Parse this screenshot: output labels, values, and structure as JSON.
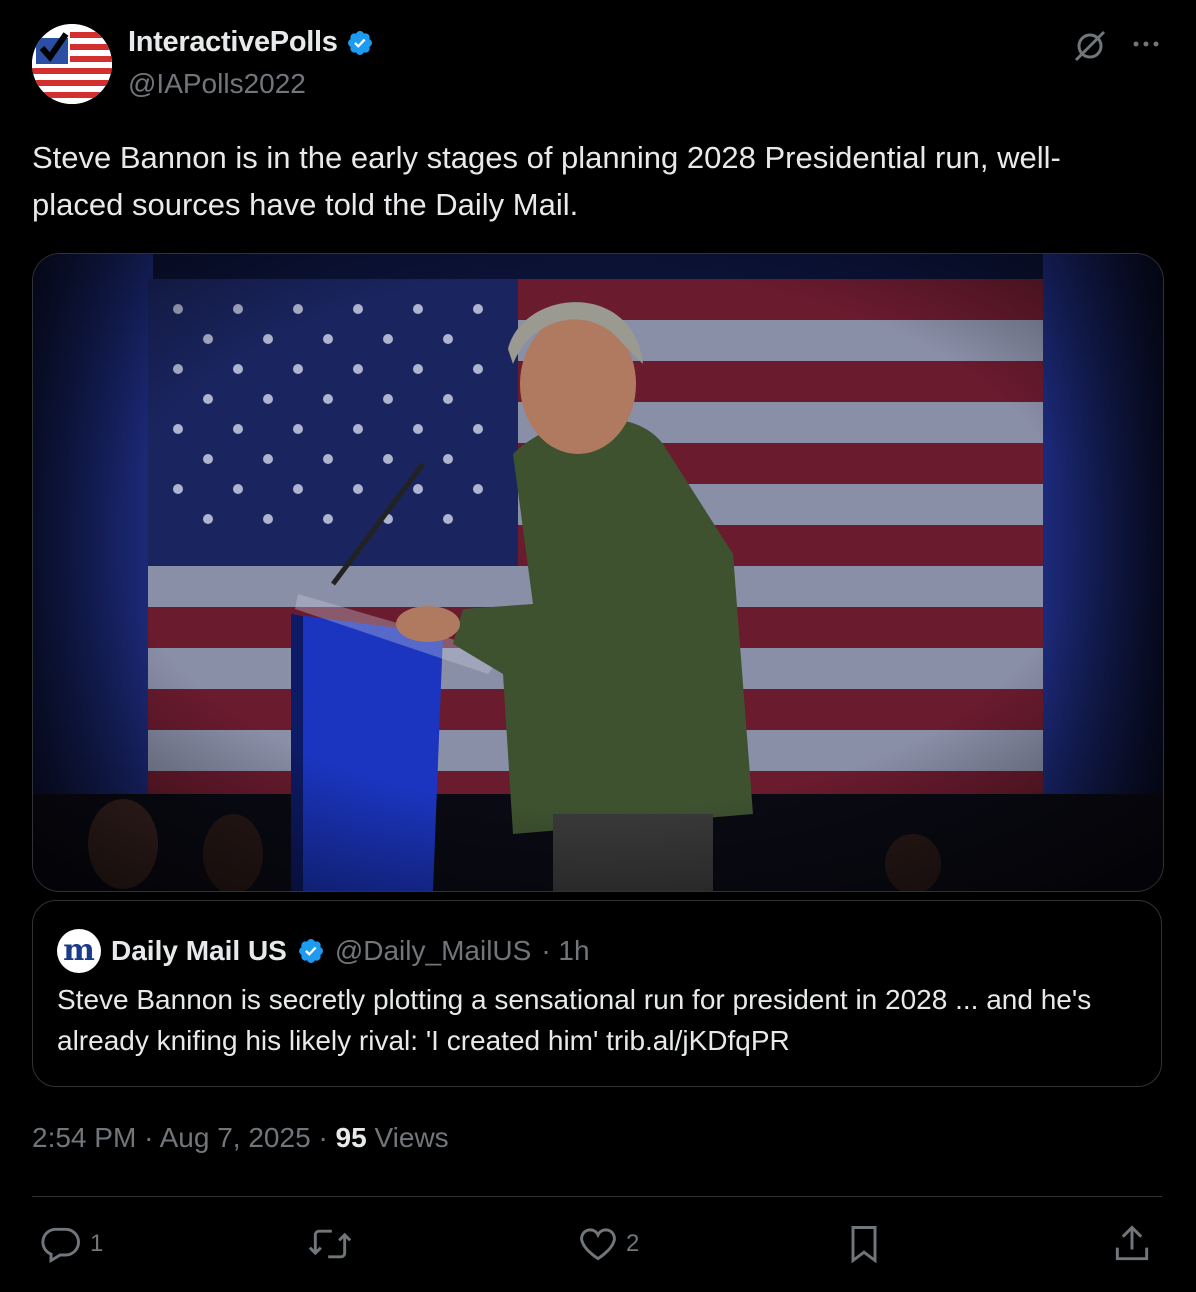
{
  "author": {
    "name": "InteractivePolls",
    "handle": "@IAPolls2022"
  },
  "tweet": {
    "text": "Steve Bannon is in the early stages of planning 2028 Presidential run, well-placed sources have told the Daily Mail."
  },
  "quote": {
    "name": "Daily Mail US",
    "handle": "@Daily_MailUS",
    "time": "· 1h",
    "text": "Steve Bannon is secretly plotting a sensational run for president in 2028 ... and he's already knifing his likely rival: 'I created him' trib.al/jKDfqPR",
    "avatar_letter": "m"
  },
  "meta": {
    "time": "2:54 PM",
    "date": "Aug 7, 2025",
    "views_count": "95",
    "views_label": "Views"
  },
  "actions": {
    "replies": "1",
    "likes": "2"
  },
  "colors": {
    "verified": "#1d9bf0",
    "muted": "#71767b",
    "border": "#2f3336"
  }
}
